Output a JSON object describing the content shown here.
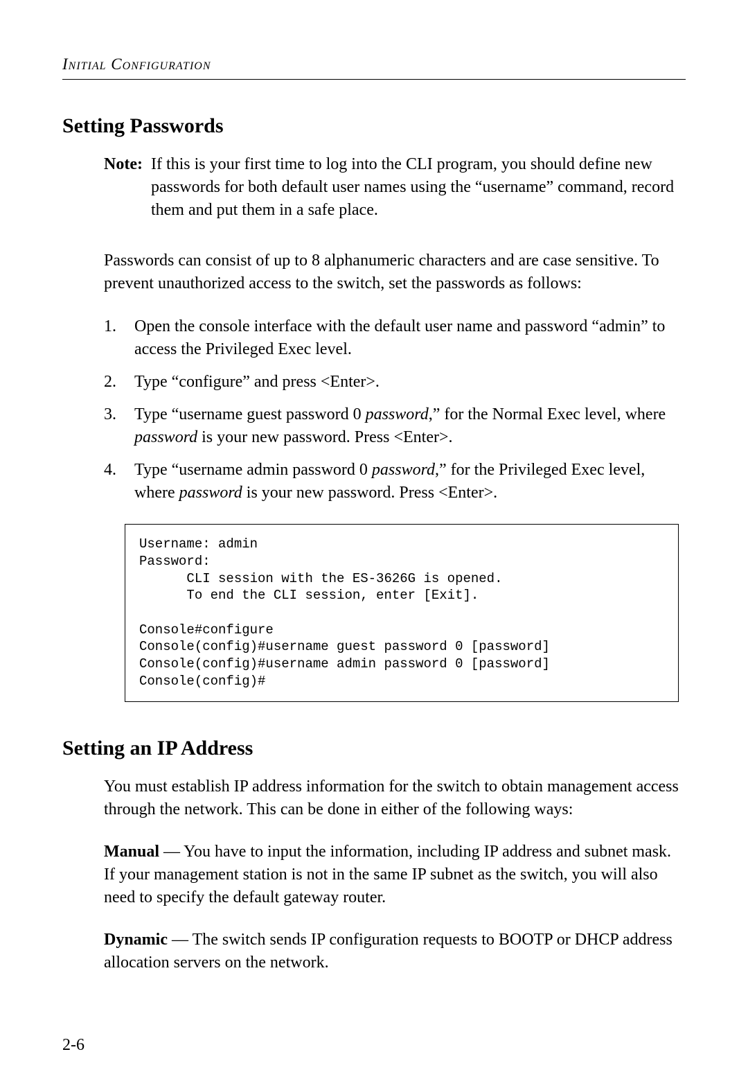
{
  "header": {
    "running_title": "Initial Configuration"
  },
  "section1": {
    "heading": "Setting Passwords",
    "note_label": "Note:",
    "note_text": "If this is your first time to log into the CLI program, you should define new passwords for both default user names using the “username” command, record them and put them in a safe place.",
    "intro": "Passwords can consist of up to 8 alphanumeric characters and are case sensitive. To prevent unauthorized access to the switch, set the passwords as follows:",
    "steps": {
      "s1": "Open the console interface with the default user name and password “admin” to access the Privileged Exec level.",
      "s2": "Type “configure” and press <Enter>.",
      "s3a": "Type “username guest password 0 ",
      "s3_italic1": "password",
      "s3b": ",” for the Normal Exec level, where ",
      "s3_italic2": "password",
      "s3c": " is your new password. Press <Enter>.",
      "s4a": "Type “username admin password 0 ",
      "s4_italic1": "password",
      "s4b": ",” for the Privileged Exec level, where ",
      "s4_italic2": "password",
      "s4c": " is your new password. Press <Enter>."
    },
    "code": "Username: admin\nPassword:\n      CLI session with the ES-3626G is opened.\n      To end the CLI session, enter [Exit].\n\nConsole#configure\nConsole(config)#username guest password 0 [password]\nConsole(config)#username admin password 0 [password]\nConsole(config)#"
  },
  "section2": {
    "heading": "Setting an IP Address",
    "intro": "You must establish IP address information for the switch to obtain management access through the network. This can be done in either of the following ways:",
    "manual_label": "Manual",
    "manual_text": " — You have to input the information, including IP address and subnet mask. If your management station is not in the same IP subnet as the switch, you will also need to specify the default gateway router.",
    "dynamic_label": "Dynamic",
    "dynamic_text": " — The switch sends IP configuration requests to BOOTP or DHCP address allocation servers on the network."
  },
  "page_number": "2-6"
}
